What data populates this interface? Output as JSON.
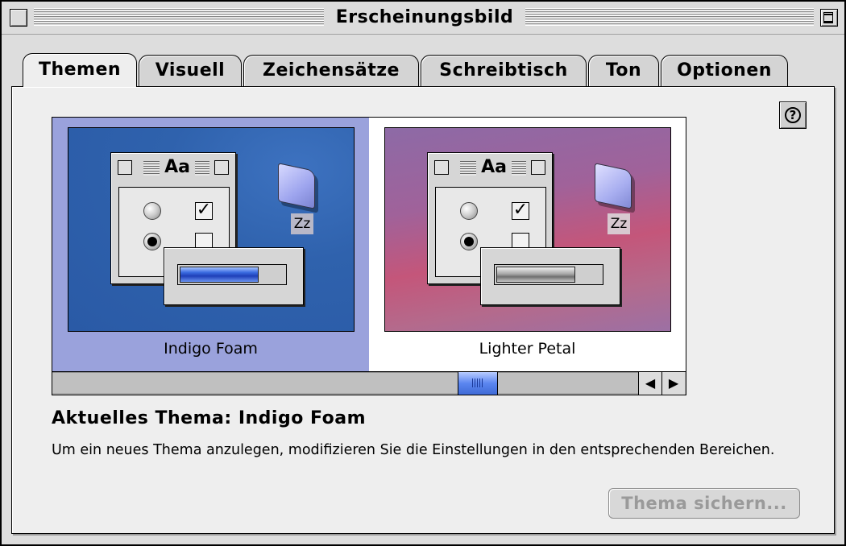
{
  "window": {
    "title": "Erscheinungsbild"
  },
  "tabs": [
    {
      "label": "Themen",
      "active": true
    },
    {
      "label": "Visuell",
      "active": false
    },
    {
      "label": "Zeichensätze",
      "active": false
    },
    {
      "label": "Schreibtisch",
      "active": false
    },
    {
      "label": "Ton",
      "active": false
    },
    {
      "label": "Optionen",
      "active": false
    }
  ],
  "help_label": "?",
  "themes": [
    {
      "name": "Indigo Foam",
      "selected": true,
      "preview_title": "Aa",
      "folder_label": "Zz",
      "accent": "#2f62ad"
    },
    {
      "name": "Lighter Petal",
      "selected": false,
      "preview_title": "Aa",
      "folder_label": "Zz",
      "accent": "#b4608c"
    }
  ],
  "current_theme_text": "Aktuelles Thema: Indigo Foam",
  "description": "Um ein neues Thema anzulegen, modifizieren Sie die Einstellungen in den entsprechenden Bereichen.",
  "save_button_label": "Thema sichern...",
  "scroll_arrows": {
    "left": "◀",
    "right": "▶"
  },
  "colors": {
    "selection_bg": "#9aa2dc",
    "scroll_thumb": "#5b86f0",
    "disabled_text": "#9a9a9a"
  }
}
